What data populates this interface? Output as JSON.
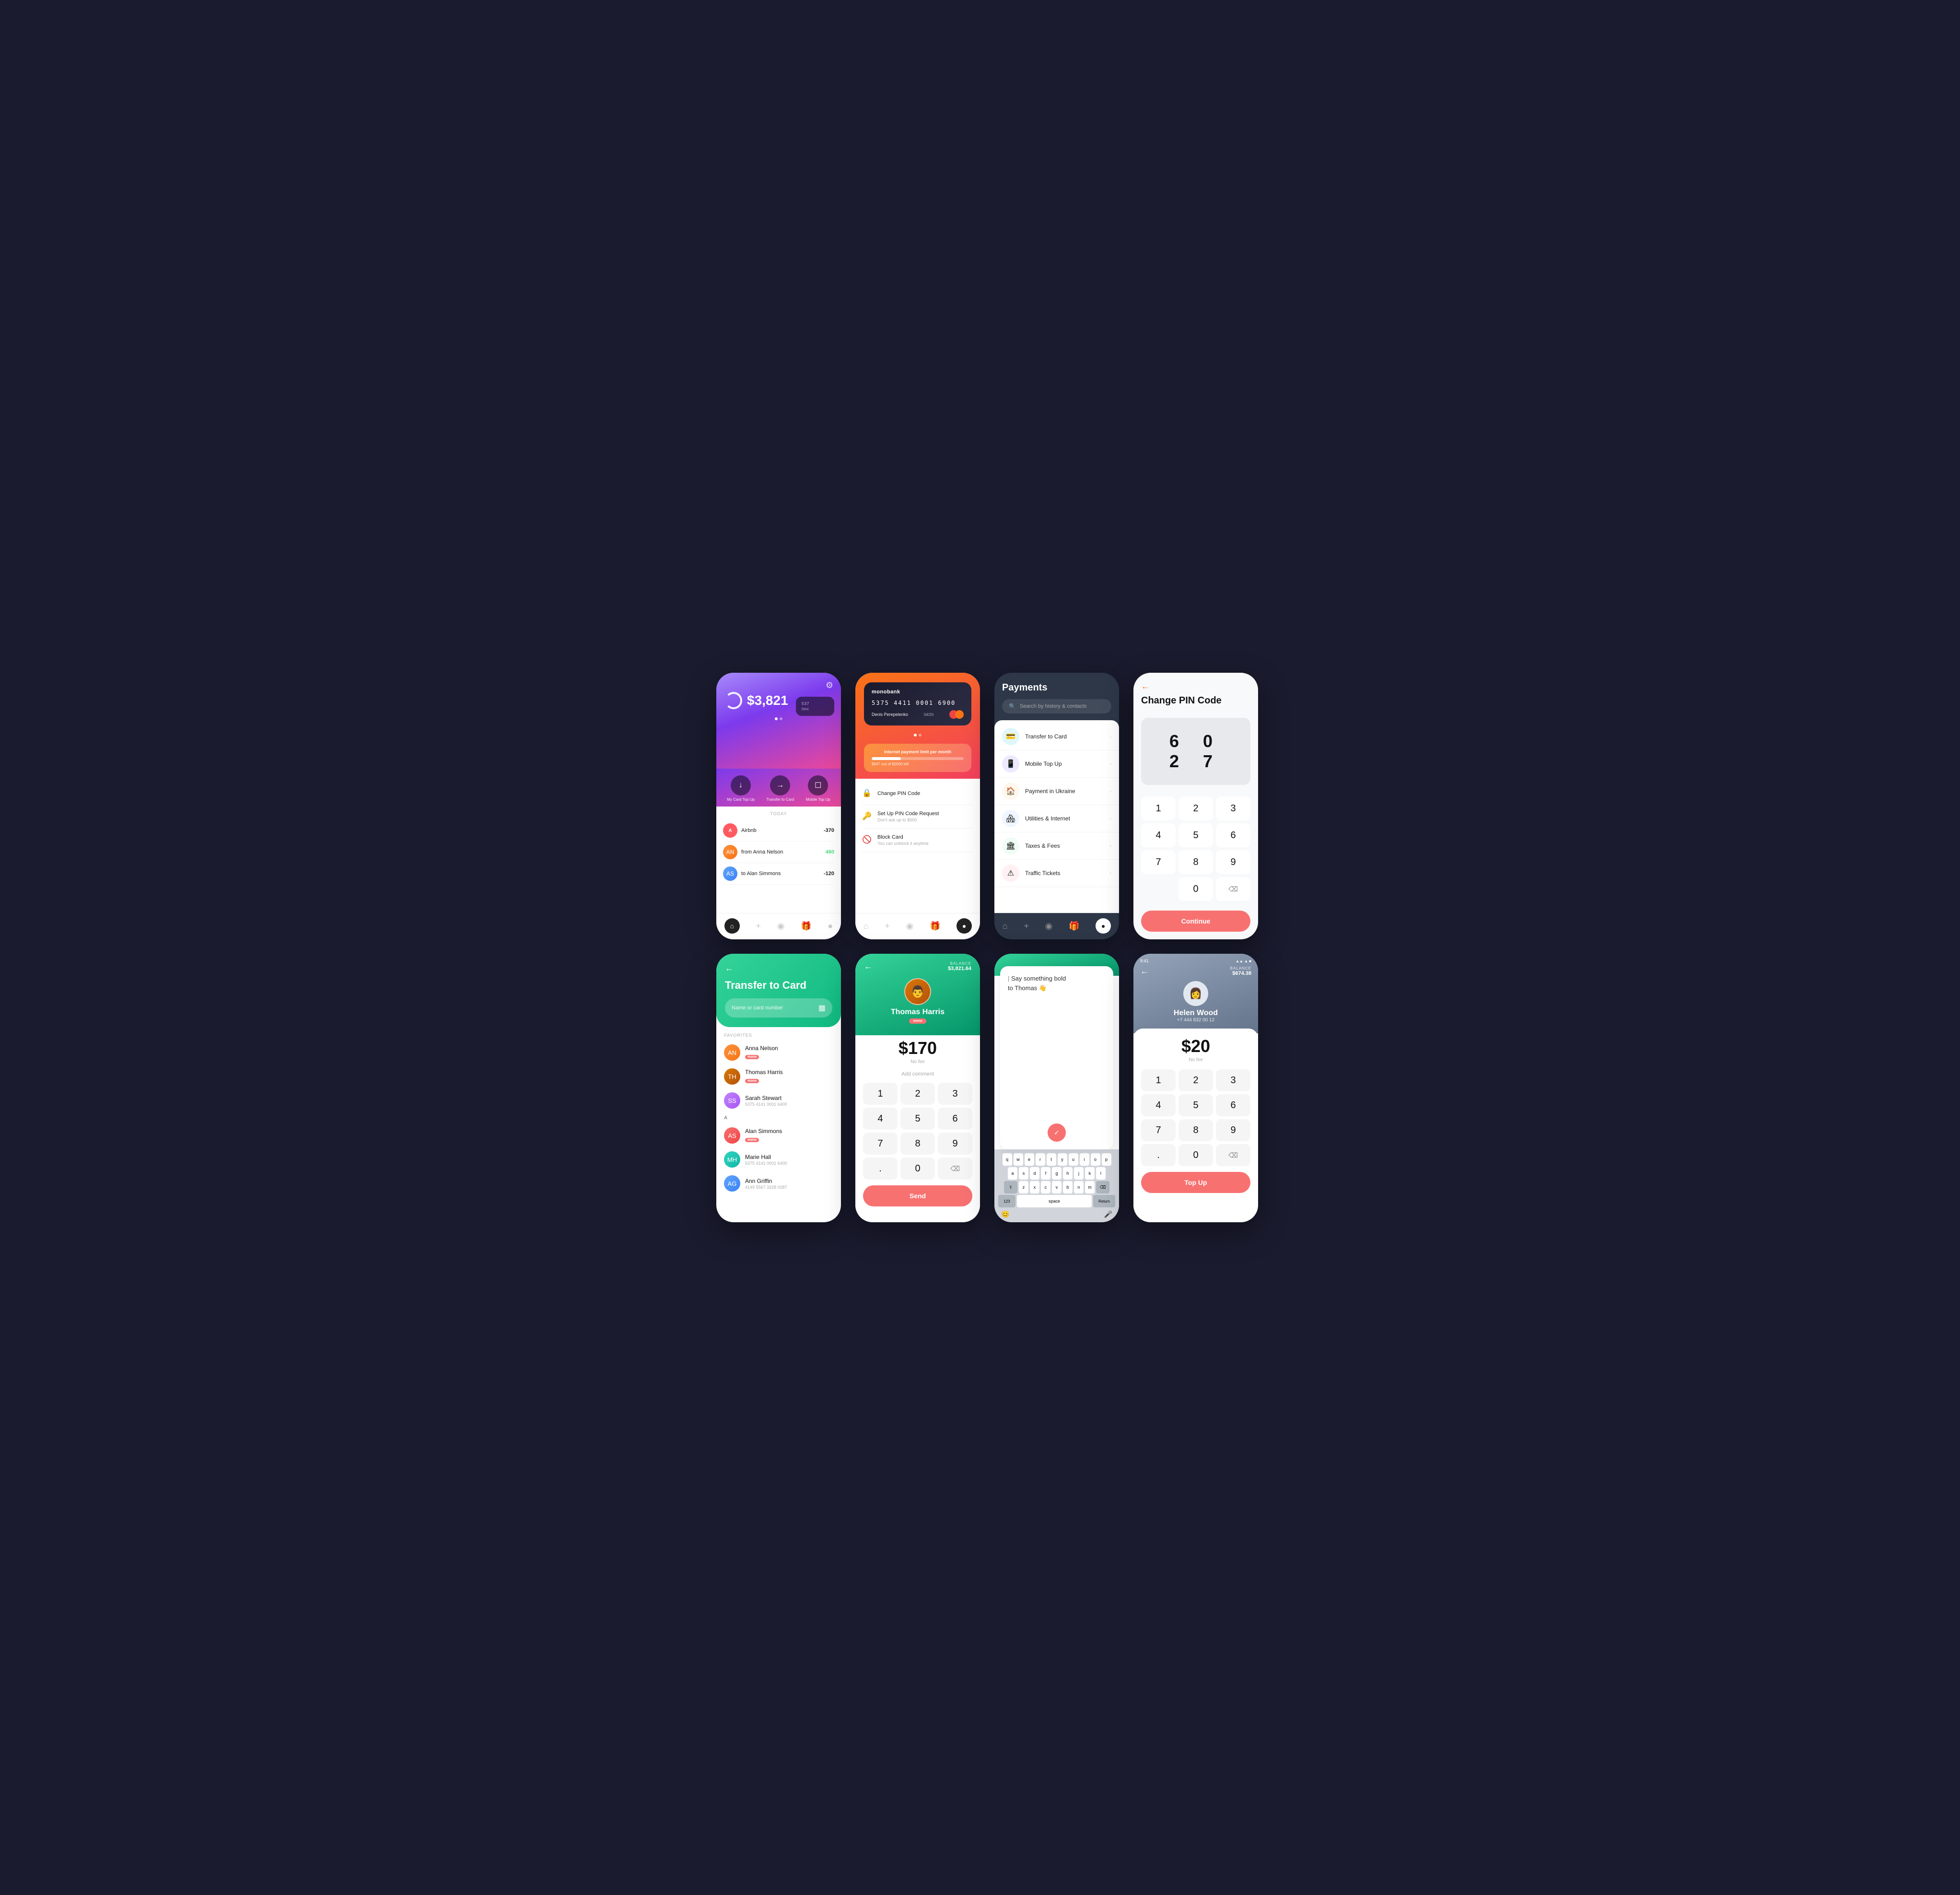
{
  "screen1": {
    "balance": "$3,821",
    "card_num_short": "537",
    "card_name_short": "Deni",
    "actions": [
      {
        "icon": "↓",
        "label": "My Card\nTop Up"
      },
      {
        "icon": "→",
        "label": "Transfer\nto Card"
      },
      {
        "icon": "☐",
        "label": "Mobile\nTop Up"
      }
    ],
    "today_label": "TODAY",
    "transactions": [
      {
        "name": "Airbnb",
        "amount": "-370",
        "type": "negative",
        "initials": "A"
      },
      {
        "name": "from Anna Nelson",
        "amount": "+460",
        "type": "positive",
        "initials": "AN"
      },
      {
        "name": "to Alan Simmons",
        "amount": "-120",
        "type": "negative",
        "initials": "AS"
      }
    ]
  },
  "screen2": {
    "bank_name": "monobank",
    "card_number": "5375 4411 0001 6900",
    "expiry": "04/20",
    "card_name": "Denis Perepelenko",
    "limit_label": "Internet payment limit per month",
    "limit_sub": "$647 out of $2000 left",
    "menu_items": [
      {
        "icon": "🔒",
        "title": "Change PIN Code",
        "sub": ""
      },
      {
        "icon": "🔑",
        "title": "Set Up PIN Code Request",
        "sub": "Don't ask up to $500"
      },
      {
        "icon": "🚫",
        "title": "Block Card",
        "sub": "You can unblock it anytime"
      }
    ]
  },
  "screen3": {
    "title": "Payments",
    "search_placeholder": "Search by history & contacts",
    "items": [
      {
        "icon": "💳",
        "color": "#06b6d4",
        "label": "Transfer to Card"
      },
      {
        "icon": "📱",
        "color": "#6366f1",
        "label": "Mobile Top Up"
      },
      {
        "icon": "🏠",
        "color": "#f97316",
        "label": "Payment in Ukraine"
      },
      {
        "icon": "🏘",
        "color": "#3b82f6",
        "label": "Utilities & Internet"
      },
      {
        "icon": "🏛",
        "color": "#22c55e",
        "label": "Taxes & Fees"
      },
      {
        "icon": "⚠",
        "color": "#ef4444",
        "label": "Traffic Tickets"
      }
    ]
  },
  "screen4": {
    "back_icon": "←",
    "title": "Change PIN Code",
    "pin_digits": "6  0  2  7",
    "numpad": [
      "1",
      "2",
      "3",
      "4",
      "5",
      "6",
      "7",
      "8",
      "9",
      "",
      "0",
      "⌫"
    ],
    "continue_label": "Continue"
  },
  "screen5": {
    "back_icon": "←",
    "title": "Transfer to Card",
    "input_placeholder": "Name or card number",
    "scan_icon": "▦",
    "favorites_label": "FAVORITES",
    "favorites": [
      {
        "name": "Anna Nelson",
        "badge": "mono",
        "sub": ""
      },
      {
        "name": "Thomas Harris",
        "badge": "mono",
        "sub": ""
      },
      {
        "name": "Sarah Stewart",
        "badge": "",
        "sub": "5375 4141 0001 6400"
      }
    ],
    "divider": "A",
    "contacts": [
      {
        "name": "Alan Simmons",
        "badge": "mono",
        "sub": ""
      },
      {
        "name": "Marie Hall",
        "badge": "",
        "sub": "5375 4141 0001 6400"
      },
      {
        "name": "Ann Griffin",
        "badge": "",
        "sub": "4149 5567 3328 0287"
      }
    ]
  },
  "screen6": {
    "back_icon": "←",
    "balance_label": "BALANCE",
    "balance_value": "$3,821.64",
    "person_name": "Thomas Harris",
    "badge": "mono",
    "amount": "$170",
    "no_fee": "No fee",
    "add_comment": "Add comment",
    "numpad": [
      "1",
      "2",
      "3",
      "4",
      "5",
      "6",
      "7",
      "8",
      "9",
      ".",
      "0",
      "⌫"
    ],
    "send_label": "Send"
  },
  "screen7": {
    "message_placeholder": "Say something bold\nto Thomas 👋",
    "down_icon": "✓",
    "keyboard_rows": [
      [
        "q",
        "w",
        "e",
        "r",
        "t",
        "y",
        "u",
        "i",
        "o",
        "p"
      ],
      [
        "a",
        "s",
        "d",
        "f",
        "g",
        "h",
        "j",
        "k",
        "l"
      ],
      [
        "⇧",
        "z",
        "x",
        "c",
        "v",
        "b",
        "n",
        "m",
        "⌫"
      ],
      [
        "123",
        "space",
        "Return"
      ]
    ],
    "emoji_icon": "😊",
    "mic_icon": "🎤"
  },
  "screen8": {
    "time": "9:41",
    "signal_icons": "▲▲▲ ▲ ■■",
    "back_icon": "←",
    "balance_label": "BALANCE",
    "balance_value": "$674.38",
    "person_name": "Helen Wood",
    "phone": "+7 444 832 00 12",
    "amount": "$20",
    "no_fee": "No fee",
    "numpad": [
      "1",
      "2",
      "3",
      "4",
      "5",
      "6",
      "7",
      "8",
      "9",
      ".",
      "0",
      "⌫"
    ],
    "topup_label": "Top Up"
  }
}
